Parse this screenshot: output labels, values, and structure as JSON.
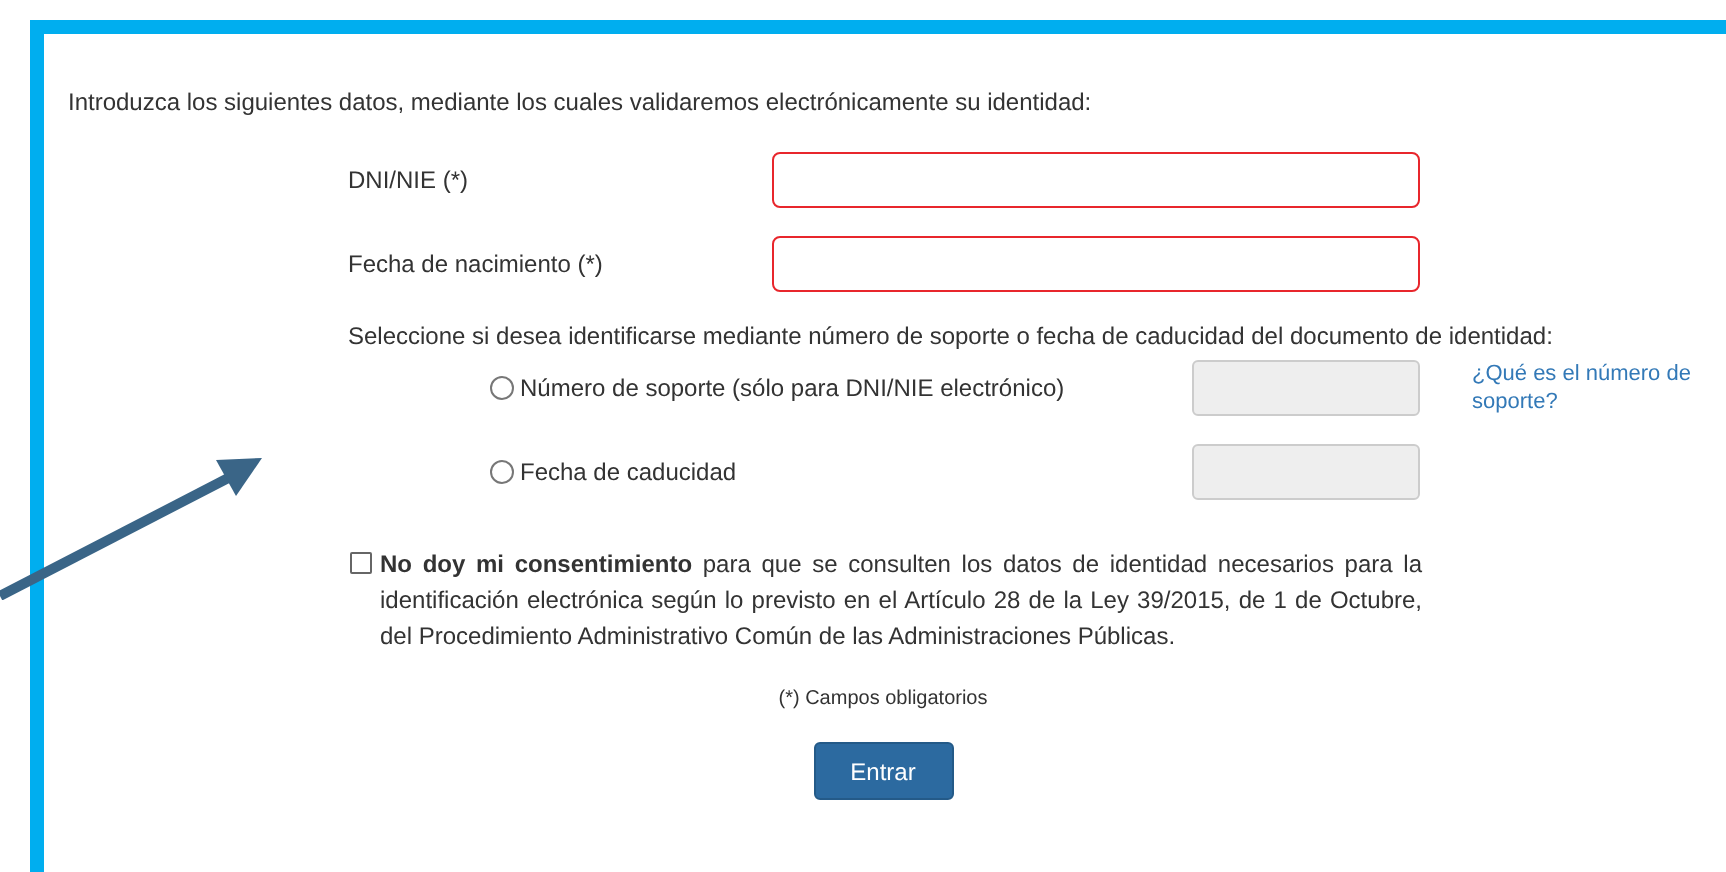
{
  "intro": "Introduzca los siguientes datos, mediante los cuales validaremos electrónicamente su identidad:",
  "fields": [
    {
      "label": "DNI/NIE (*)",
      "invalid": true
    },
    {
      "label": "Fecha de nacimiento (*)",
      "invalid": true
    }
  ],
  "choice_prompt": "Seleccione si desea identificarse mediante número de soporte o fecha de caducidad del documento de identidad:",
  "options": [
    {
      "label": "Número de soporte (sólo para DNI/NIE electrónico)",
      "selected": false,
      "field_disabled": true,
      "help_link": "¿Qué es el número de soporte?"
    },
    {
      "label": "Fecha de caducidad",
      "selected": false,
      "field_disabled": true
    }
  ],
  "consent": {
    "text": "**No doy mi consentimiento** para que se consulten los datos de identidad necesarios para la identificación electrónica según lo previsto en el Artículo 28 de la Ley 39/2015, de 1 de Octubre, del Procedimiento Administrativo Común de las Administraciones Públicas.",
    "checked": false
  },
  "required_note": "(*) Campos obligatorios",
  "submit_button": "Entrar"
}
